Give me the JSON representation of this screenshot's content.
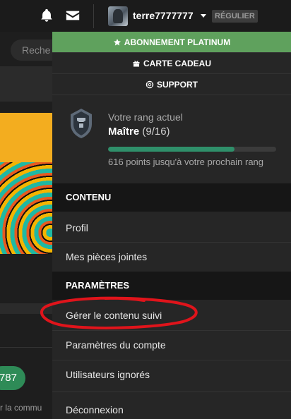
{
  "header": {
    "username": "terre7777777",
    "role_badge": "RÉGULIER",
    "icons": [
      "bell-icon",
      "envelope-icon",
      "chevron-down-icon"
    ]
  },
  "background": {
    "search_placeholder": "Reche",
    "pill_value": "787",
    "snippet_text": "r la commu"
  },
  "menu": {
    "top_buttons": [
      {
        "label": "ABONNEMENT PLATINUM",
        "icon": "star-icon"
      },
      {
        "label": "CARTE CADEAU",
        "icon": "gift-icon"
      },
      {
        "label": "SUPPORT",
        "icon": "lifebuoy-icon"
      }
    ],
    "rank": {
      "caption": "Votre rang actuel",
      "name": "Maître",
      "level": "(9/16)",
      "progress_fraction": 0.75,
      "progress_text": "616 points jusqu'à votre prochain rang"
    },
    "sections": [
      {
        "title": "CONTENU",
        "items": [
          "Profil",
          "Mes pièces jointes"
        ]
      },
      {
        "title": "PARAMÈTRES",
        "items": [
          "Gérer le contenu suivi",
          "Paramètres du compte",
          "Utilisateurs ignorés"
        ]
      }
    ],
    "logout": "Déconnexion"
  },
  "colors": {
    "accent_green": "#5fa15d",
    "progress_green": "#2f8f6a",
    "annotation_red": "#e0141b",
    "background": "#1e1e1e",
    "menu_bg": "#262626",
    "section_bg": "#161616"
  }
}
